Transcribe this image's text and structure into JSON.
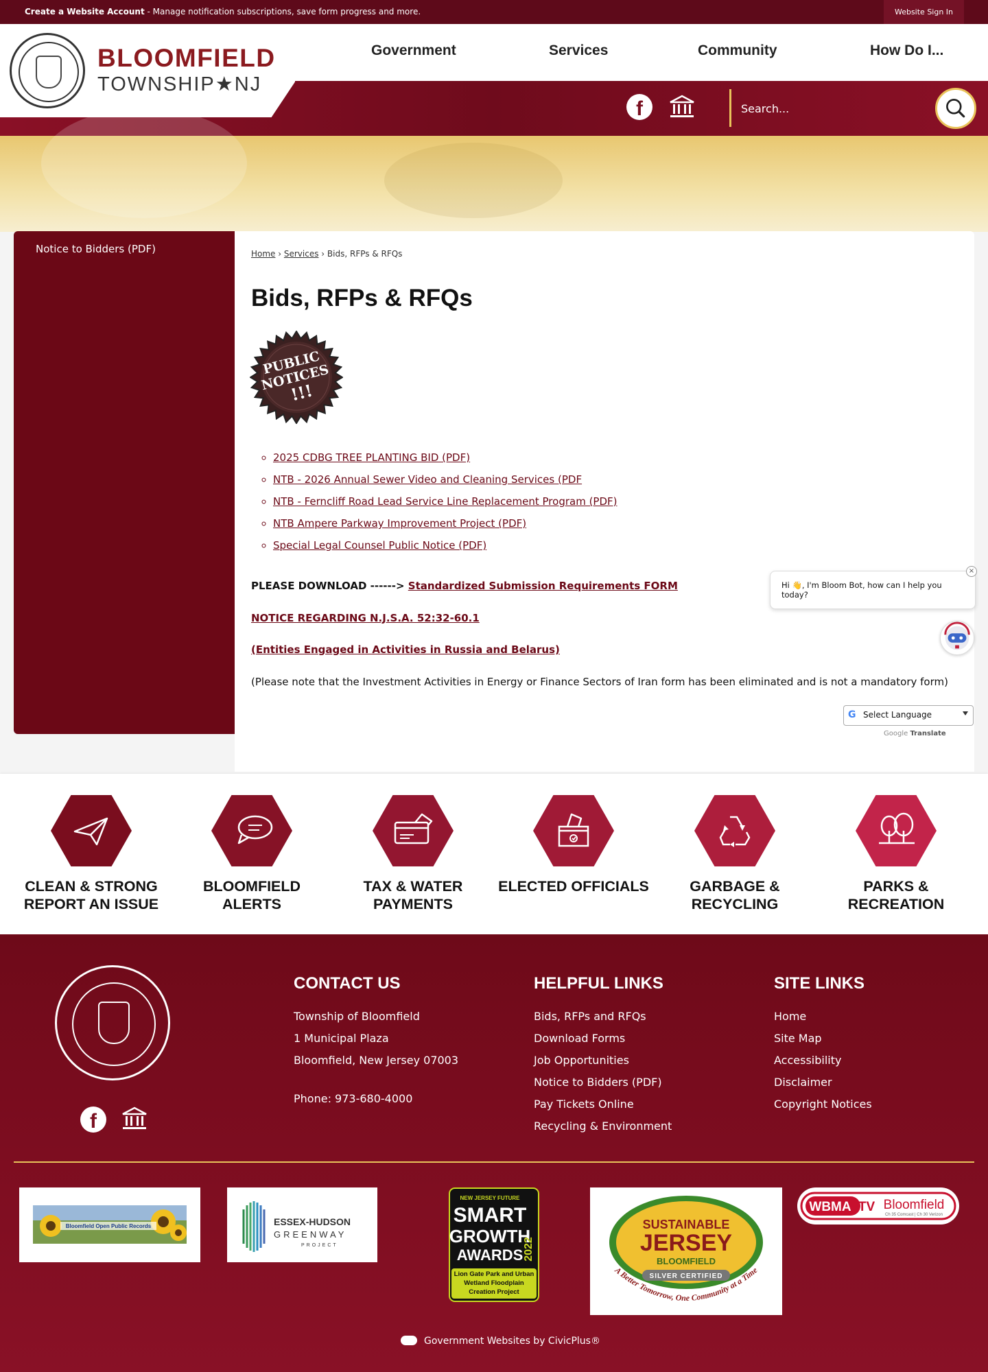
{
  "topbar": {
    "create_account": "Create a Website Account",
    "create_desc": " - Manage notification subscriptions, save form progress and more.",
    "sign_in": "Website Sign In"
  },
  "brand": {
    "name1": "BLOOMFIELD",
    "name2": "TOWNSHIP★NJ"
  },
  "nav": [
    "Government",
    "Services",
    "Community",
    "How Do I..."
  ],
  "search": {
    "placeholder": "Search..."
  },
  "sidebar": {
    "items": [
      "Notice to Bidders (PDF)"
    ]
  },
  "breadcrumb": {
    "home": "Home",
    "services": "Services",
    "current": "Bids, RFPs & RFQs"
  },
  "page": {
    "title": "Bids, RFPs & RFQs",
    "badge_text1": "PUBLIC",
    "badge_text2": "NOTICES",
    "badge_text3": "!!!",
    "links": [
      "2025 CDBG TREE PLANTING BID (PDF)",
      "NTB - 2026 Annual Sewer Video and Cleaning Services (PDF",
      "NTB - Ferncliff Road Lead Service Line Replacement Program (PDF)",
      "NTB Ampere Parkway Improvement Project (PDF)",
      "Special Legal Counsel Public Notice (PDF)"
    ],
    "download_prefix": "PLEASE DOWNLOAD ------> ",
    "download_link": "Standardized Submission Requirements FORM",
    "notice_link": "NOTICE REGARDING N.J.S.A. 52:32-60.1",
    "entities_link": "(Entities Engaged in Activities in Russia and Belarus)",
    "iran_note": "(Please note that the Investment Activities in Energy or Finance Sectors of Iran form has been eliminated and is not a mandatory form)"
  },
  "chat": {
    "message": "Hi 👋, I'm Bloom Bot, how can I help you today?",
    "close": "×"
  },
  "translate": {
    "select": "Select Language",
    "powered_by": "Google",
    "translate_word": "Translate"
  },
  "quicklinks": [
    {
      "line1": "CLEAN & STRONG",
      "line2": "REPORT AN ISSUE",
      "color": "#7a0d1e",
      "icon": "paper-plane-icon"
    },
    {
      "line1": "BLOOMFIELD",
      "line2": "ALERTS",
      "color": "#861226",
      "icon": "chat-bubbles-icon"
    },
    {
      "line1": "TAX & WATER",
      "line2": "PAYMENTS",
      "color": "#931630",
      "icon": "payment-card-icon"
    },
    {
      "line1": "ELECTED OFFICIALS",
      "line2": "",
      "color": "#a01a36",
      "icon": "ballot-box-icon"
    },
    {
      "line1": "GARBAGE &",
      "line2": "RECYCLING",
      "color": "#ad1e3c",
      "icon": "recycle-icon"
    },
    {
      "line1": "PARKS &",
      "line2": "RECREATION",
      "color": "#c2244a",
      "icon": "trees-icon"
    }
  ],
  "footer": {
    "contact": {
      "heading": "CONTACT US",
      "lines": [
        "Township of Bloomfield",
        "1 Municipal Plaza",
        "Bloomfield, New Jersey 07003"
      ],
      "phone": "Phone: 973-680-4000"
    },
    "helpful": {
      "heading": "HELPFUL LINKS",
      "links": [
        "Bids, RFPs and RFQs",
        "Download Forms",
        "Job Opportunities",
        "Notice to Bidders (PDF)",
        "Pay Tickets Online",
        "Recycling & Environment"
      ]
    },
    "site": {
      "heading": "SITE LINKS",
      "links": [
        "Home",
        "Site Map",
        "Accessibility",
        "Disclaimer",
        "Copyright Notices"
      ]
    },
    "partners": {
      "opra": "Bloomfield Open Public Records",
      "essex1": "ESSEX-HUDSON",
      "essex2": "GREENWAY",
      "essex3": "PROJECT",
      "smart_top": "NEW JERSEY FUTURE",
      "smart1": "SMART",
      "smart2": "GROWTH",
      "smart3": "AWARDS",
      "smart_year": "2022",
      "smart_caption": "Lion Gate Park and Urban Wetland Floodplain Creation Project",
      "sj1": "SUSTAINABLE",
      "sj2": "JERSEY",
      "sj3": "BLOOMFIELD",
      "sj4": "SILVER CERTIFIED",
      "sj5": "A Better Tomorrow, One Community at a Time",
      "wbma1": "WBMA",
      "wbma2": "TV",
      "wbma3": "Bloomfield",
      "wbma4": "Ch 35 Comcast | Ch 30 Verizon"
    },
    "civicplus": "Government Websites by CivicPlus®"
  }
}
